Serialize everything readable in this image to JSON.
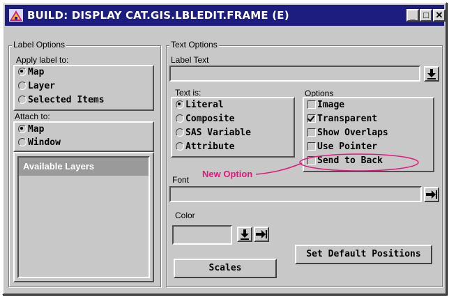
{
  "window": {
    "title": "BUILD: DISPLAY CAT.GIS.LBLEDIT.FRAME (E)",
    "controls": {
      "minimize": "_",
      "maximize": "□",
      "close": "✕"
    }
  },
  "label_options": {
    "title": "Label Options",
    "apply_label_to": {
      "label": "Apply label to:",
      "options": [
        "Map",
        "Layer",
        "Selected Items"
      ],
      "selected": "Map"
    },
    "attach_to": {
      "label": "Attach to:",
      "options": [
        "Map",
        "Window"
      ],
      "selected": "Map"
    },
    "available_layers": {
      "label": "Available Layers"
    }
  },
  "text_options": {
    "title": "Text Options",
    "label_text": {
      "label": "Label Text",
      "value": ""
    },
    "text_is": {
      "label": "Text is:",
      "options": [
        "Literal",
        "Composite",
        "SAS Variable",
        "Attribute"
      ],
      "selected": "Literal"
    },
    "options": {
      "label": "Options",
      "items": [
        {
          "label": "Image",
          "checked": false
        },
        {
          "label": "Transparent",
          "checked": true
        },
        {
          "label": "Show Overlaps",
          "checked": false
        },
        {
          "label": "Use Pointer",
          "checked": false
        },
        {
          "label": "Send to Back",
          "checked": false
        }
      ]
    },
    "font": {
      "label": "Font",
      "value": ""
    },
    "color": {
      "label": "Color",
      "value": ""
    },
    "set_default_positions": "Set Default Positions",
    "scales": "Scales"
  },
  "annotation": {
    "text": "New Option",
    "color": "#e0197d"
  },
  "colors": {
    "title_bar": "#1c1d7f",
    "panel": "#c8c8c8",
    "annotation": "#e0197d"
  },
  "icons": [
    "window-app-icon",
    "download-arrow-icon",
    "right-arrow-bar-icon"
  ]
}
